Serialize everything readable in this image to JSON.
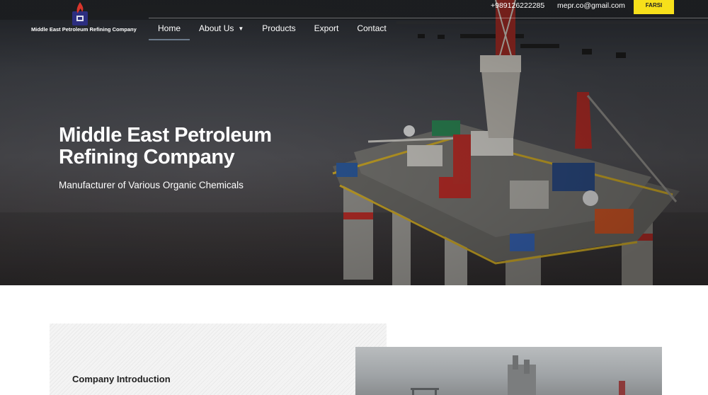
{
  "brand": {
    "name": "Middle East Petroleum Refining Company",
    "logo_icon": "flame-logo-icon",
    "accent": "#f7e01b"
  },
  "topbar": {
    "phone": "+989126222285",
    "email": "mepr.co@gmail.com",
    "language_button": "FARSI"
  },
  "nav": {
    "items": [
      {
        "label": "Home",
        "active": true
      },
      {
        "label": "About Us",
        "has_dropdown": true
      },
      {
        "label": "Products"
      },
      {
        "label": "Export"
      },
      {
        "label": "Contact"
      }
    ]
  },
  "hero": {
    "title": "Middle East Petroleum Refining Company",
    "subtitle": "Manufacturer of Various Organic Chemicals"
  },
  "intro": {
    "heading": "Company Introduction"
  }
}
